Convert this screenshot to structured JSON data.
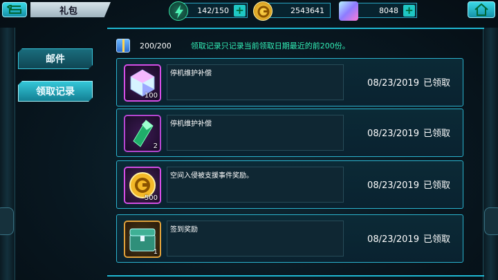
{
  "header": {
    "title": "礼包",
    "stamina": "142/150",
    "gold": "2543641",
    "gems": "8048"
  },
  "tabs": [
    {
      "label": "邮件",
      "active": false
    },
    {
      "label": "领取记录",
      "active": true
    }
  ],
  "summary": {
    "count": "200/200",
    "note": "领取记录只记录当前领取日期最近的前200份。"
  },
  "records": [
    {
      "icon": "crystal-gem-icon",
      "qty": "100",
      "desc": "停机维护补偿",
      "date": "08/23/2019",
      "status": "已领取"
    },
    {
      "icon": "green-crystal-icon",
      "qty": "2",
      "desc": "停机维护补偿",
      "date": "08/23/2019",
      "status": "已领取"
    },
    {
      "icon": "gold-coin-icon",
      "qty": "500",
      "desc": "空间入侵被支援事件奖励。",
      "date": "08/23/2019",
      "status": "已领取"
    },
    {
      "icon": "treasure-chest-icon",
      "qty": "1",
      "desc": "签到奖励",
      "date": "08/23/2019",
      "status": "已领取"
    }
  ],
  "colors": {
    "accent": "#1fb9d3",
    "note": "#33f0b8",
    "rare_border": "#d54ee6",
    "epic_border": "#e0a13a"
  }
}
